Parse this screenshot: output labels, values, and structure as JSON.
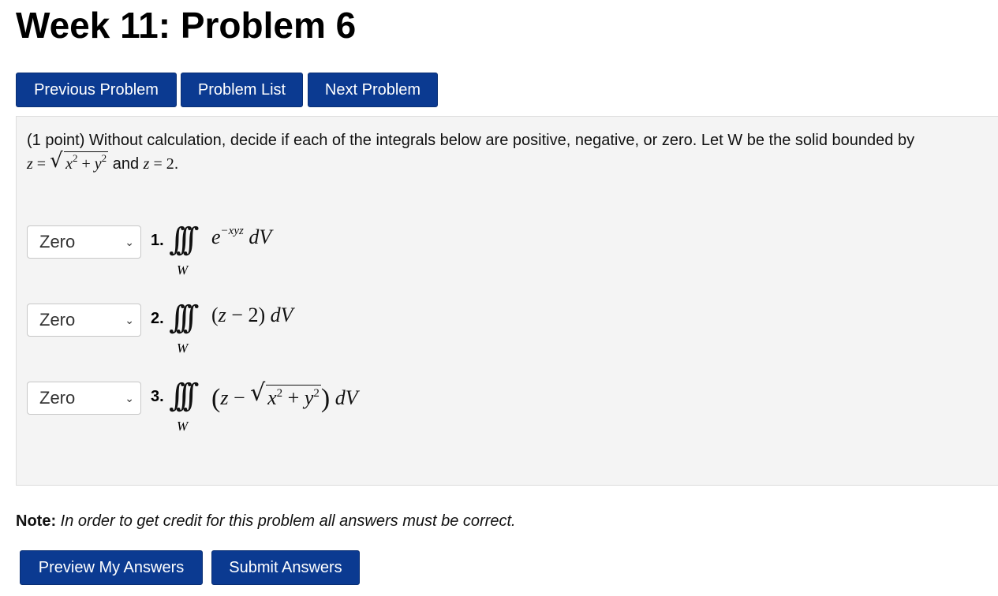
{
  "page": {
    "title": "Week 11: Problem 6"
  },
  "nav": {
    "previous_label": "Previous Problem",
    "list_label": "Problem List",
    "next_label": "Next Problem"
  },
  "problem": {
    "intro_text": "(1 point) Without calculation, decide if each of the integrals below are positive, negative, or zero. Let W be the solid bounded by",
    "intro_and": "and",
    "intro_end": ".",
    "items": [
      {
        "number": "1.",
        "selected": "Zero",
        "region": "W"
      },
      {
        "number": "2.",
        "selected": "Zero",
        "region": "W"
      },
      {
        "number": "3.",
        "selected": "Zero",
        "region": "W"
      }
    ]
  },
  "note": {
    "label": "Note:",
    "text": "In order to get credit for this problem all answers must be correct."
  },
  "actions": {
    "preview_label": "Preview My Answers",
    "submit_label": "Submit Answers"
  },
  "colors": {
    "button_bg": "#0b3a91",
    "panel_bg": "#f4f4f4"
  }
}
